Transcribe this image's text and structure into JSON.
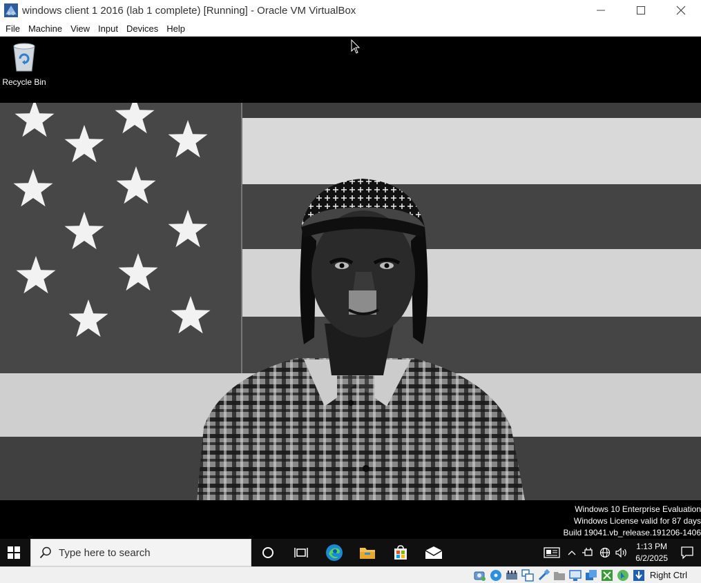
{
  "window": {
    "title": "windows client 1 2016 (lab 1 complete) [Running] - Oracle VM VirtualBox",
    "controls": [
      "minimize",
      "maximize",
      "close"
    ]
  },
  "menubar": {
    "items": [
      "File",
      "Machine",
      "View",
      "Input",
      "Devices",
      "Help"
    ]
  },
  "desktop": {
    "icons": [
      {
        "label": "Recycle Bin",
        "icon": "recycle-bin-icon"
      }
    ],
    "watermark": {
      "line1": "Windows 10 Enterprise Evaluation",
      "line2": "Windows License valid for 87 days",
      "line3": "Build 19041.vb_release.191206-1406"
    }
  },
  "taskbar": {
    "search_placeholder": "Type here to search",
    "pinned": [
      "cortana-icon",
      "task-view-icon",
      "edge-icon",
      "file-explorer-icon",
      "store-icon",
      "mail-icon"
    ],
    "clock": {
      "time": "1:13 PM",
      "date": "6/2/2025"
    }
  },
  "statusbar": {
    "host_key": "Right Ctrl",
    "icons": [
      "hard-disk-icon",
      "optical-drive-icon",
      "audio-icon",
      "network-icon",
      "usb-icon",
      "shared-folders-icon",
      "display-icon",
      "video-capture-icon",
      "guest-additions-icon",
      "mouse-integration-icon",
      "keyboard-capture-icon"
    ]
  },
  "colors": {
    "taskbar": "#101010",
    "accent_blue": "#0078d7"
  }
}
